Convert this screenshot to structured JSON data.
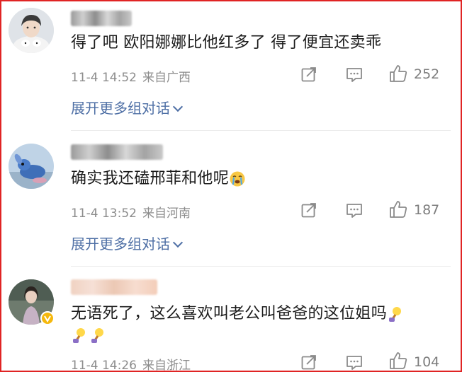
{
  "comments": [
    {
      "text": "得了吧 欧阳娜娜比他红多了 得了便宜还卖乖",
      "date": "11-4 14:52",
      "location": "来自广西",
      "likes": "252",
      "expand_label": "展开更多组对话"
    },
    {
      "text": "确实我还磕邢菲和他呢",
      "date": "11-4 13:52",
      "location": "来自河南",
      "likes": "187",
      "expand_label": "展开更多组对话"
    },
    {
      "text": "无语死了，这么喜欢叫老公叫爸爸的这位姐吗",
      "date": "11-4 14:26",
      "location": "来自浙江",
      "likes": "104"
    }
  ],
  "colors": {
    "border": "#e02424",
    "link": "#4e6fa5",
    "meta": "#8c8c8c",
    "icon": "#8a8a8a"
  },
  "icons": [
    "share-icon",
    "comment-icon",
    "like-icon",
    "crying-emoji-icon",
    "lightbulb-emoji-icon",
    "verified-badge-icon"
  ]
}
